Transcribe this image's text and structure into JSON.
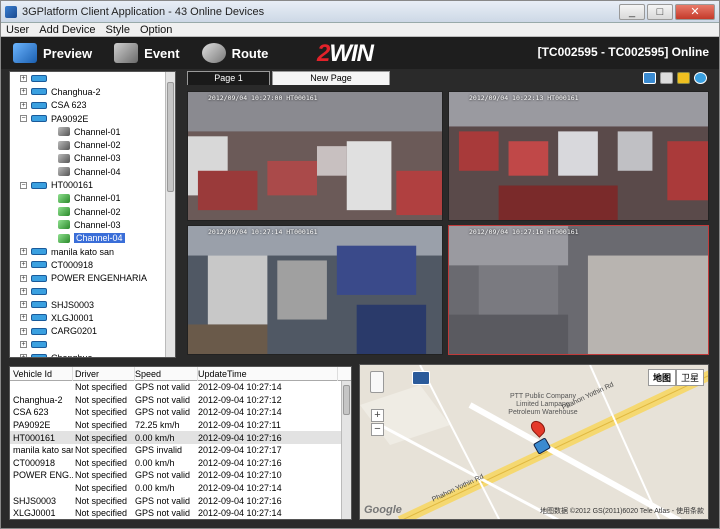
{
  "window": {
    "title": "3GPlatform Client Application - 43 Online Devices",
    "min": "_",
    "max": "□",
    "close": "✕"
  },
  "menu": [
    "User",
    "Add Device",
    "Style",
    "Option"
  ],
  "toolbar": {
    "preview": "Preview",
    "event": "Event",
    "route": "Route",
    "brand_prefix": "2",
    "brand_suffix": "WIN",
    "status": "[TC002595 - TC002595] Online"
  },
  "tree": [
    {
      "kind": "device",
      "label": ""
    },
    {
      "kind": "device",
      "label": "Changhua-2"
    },
    {
      "kind": "device",
      "label": "CSA 623"
    },
    {
      "kind": "device",
      "label": "PA9092E",
      "expanded": true
    },
    {
      "kind": "channel",
      "label": "Channel-01",
      "on": false
    },
    {
      "kind": "channel",
      "label": "Channel-02",
      "on": false
    },
    {
      "kind": "channel",
      "label": "Channel-03",
      "on": false
    },
    {
      "kind": "channel",
      "label": "Channel-04",
      "on": false
    },
    {
      "kind": "device",
      "label": "HT000161",
      "expanded": true
    },
    {
      "kind": "channel",
      "label": "Channel-01",
      "on": true
    },
    {
      "kind": "channel",
      "label": "Channel-02",
      "on": true
    },
    {
      "kind": "channel",
      "label": "Channel-03",
      "on": true
    },
    {
      "kind": "channel",
      "label": "Channel-04",
      "on": true,
      "selected": true
    },
    {
      "kind": "device",
      "label": "manila kato san"
    },
    {
      "kind": "device",
      "label": "CT000918"
    },
    {
      "kind": "device",
      "label": "POWER ENGENHARIA"
    },
    {
      "kind": "device",
      "label": ""
    },
    {
      "kind": "device",
      "label": "SHJS0003"
    },
    {
      "kind": "device",
      "label": "XLGJ0001"
    },
    {
      "kind": "device",
      "label": "CARG0201"
    },
    {
      "kind": "device",
      "label": ""
    },
    {
      "kind": "device",
      "label": "Changhua"
    }
  ],
  "tabs": [
    "Page 1",
    "New Page"
  ],
  "videos": [
    {
      "ts": "2012/09/04  10:27:00   HT000161"
    },
    {
      "ts": "2012/09/04  10:22:13   HT000161"
    },
    {
      "ts": "2012/09/04  10:27:14   HT000161"
    },
    {
      "ts": "2012/09/04  10:27:16   HT000161"
    }
  ],
  "table": {
    "headers": [
      "Vehicle Id",
      "Driver",
      "Speed",
      "UpdateTime"
    ],
    "rows": [
      [
        "",
        "Not specified",
        "GPS not valid",
        "2012-09-04 10:27:14"
      ],
      [
        "Changhua-2",
        "Not specified",
        "GPS not valid",
        "2012-09-04 10:27:12"
      ],
      [
        "CSA 623",
        "Not specified",
        "GPS not valid",
        "2012-09-04 10:27:14"
      ],
      [
        "PA9092E",
        "Not specified",
        "72.25 km/h",
        "2012-09-04 10:27:11"
      ],
      [
        "HT000161",
        "Not specified",
        "0.00 km/h",
        "2012-09-04 10:27:16"
      ],
      [
        "manila kato san",
        "Not specified",
        "GPS invalid",
        "2012-09-04 10:27:17"
      ],
      [
        "CT000918",
        "Not specified",
        "0.00 km/h",
        "2012-09-04 10:27:16"
      ],
      [
        "POWER ENG...",
        "Not specified",
        "GPS not valid",
        "2012-09-04 10:27:10"
      ],
      [
        "",
        "Not specified",
        "0.00 km/h",
        "2012-09-04 10:27:14"
      ],
      [
        "SHJS0003",
        "Not specified",
        "GPS not valid",
        "2012-09-04 10:27:16"
      ],
      [
        "XLGJ0001",
        "Not specified",
        "GPS not valid",
        "2012-09-04 10:27:14"
      ]
    ],
    "selected_index": 4
  },
  "map": {
    "type_map": "地图",
    "type_sat": "卫星",
    "zoom_in": "+",
    "zoom_out": "−",
    "poi": "PTT Public Company\nLimited Lampang\nPetroleum Warehouse",
    "road1": "Phahon Yothin Rd",
    "road2": "Phahon Yothin Rd",
    "google": "Google",
    "copyright": "地图数据 ©2012 GS(2011)6020 Tele Atlas - 使用条款"
  },
  "colors": {
    "accent": "#3a6ed8",
    "brand_red": "#e3222a",
    "pin": "#e43a2a"
  }
}
